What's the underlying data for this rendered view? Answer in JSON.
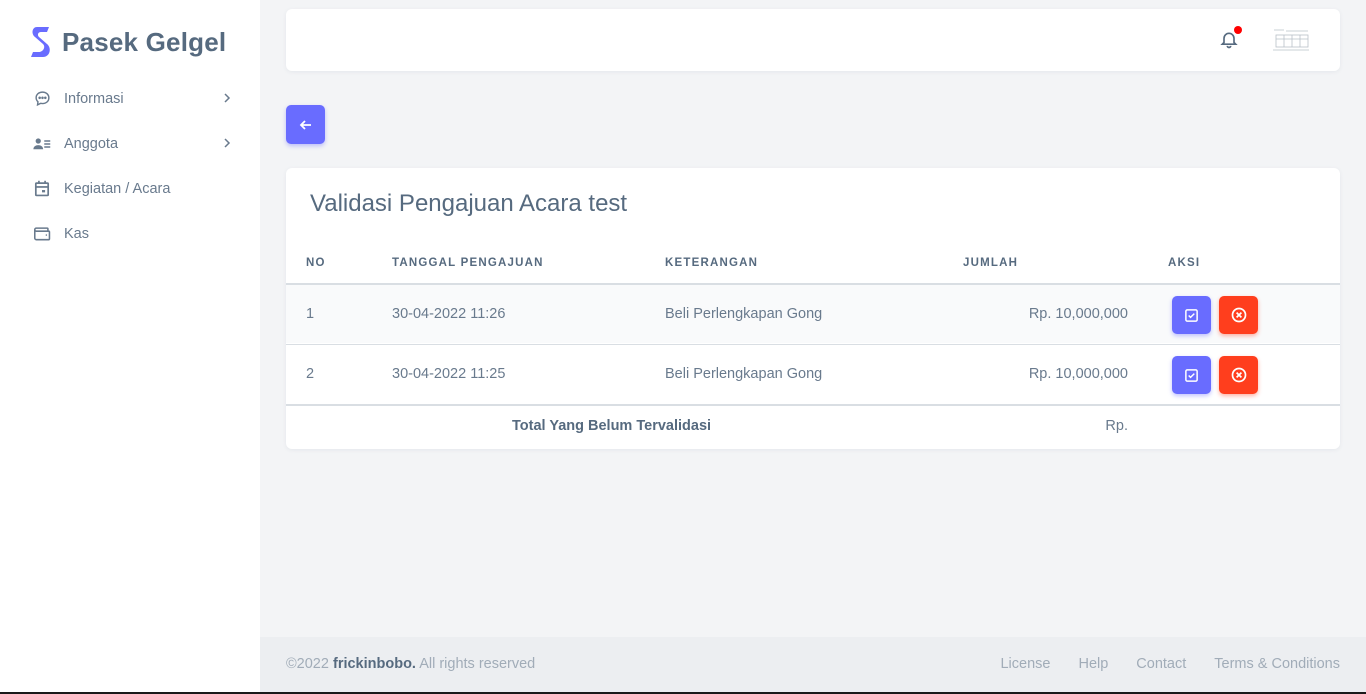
{
  "brand": {
    "name": "Pasek Gelgel",
    "color": "#696cff"
  },
  "sidebar": {
    "items": [
      {
        "label": "Informasi",
        "icon": "chat-bubble-icon",
        "has_submenu": true
      },
      {
        "label": "Anggota",
        "icon": "user-list-icon",
        "has_submenu": true
      },
      {
        "label": "Kegiatan / Acara",
        "icon": "calendar-icon",
        "has_submenu": false
      },
      {
        "label": "Kas",
        "icon": "wallet-icon",
        "has_submenu": false
      }
    ]
  },
  "navbar": {
    "notification_icon": "bell-icon",
    "has_unread": true
  },
  "back_button": {
    "icon": "arrow-left-icon"
  },
  "card": {
    "title": "Validasi Pengajuan Acara test",
    "columns": [
      "NO",
      "TANGGAL PENGAJUAN",
      "KETERANGAN",
      "JUMLAH",
      "AKSI"
    ],
    "rows": [
      {
        "no": "1",
        "tanggal": "30-04-2022 11:26",
        "keterangan": "Beli Perlengkapan Gong",
        "jumlah": "Rp. 10,000,000"
      },
      {
        "no": "2",
        "tanggal": "30-04-2022 11:25",
        "keterangan": "Beli Perlengkapan Gong",
        "jumlah": "Rp. 10,000,000"
      }
    ],
    "total_label": "Total Yang Belum Tervalidasi",
    "total_value": "Rp."
  },
  "footer": {
    "copyright_prefix": "©2022 ",
    "author": "frickinbobo.",
    "copyright_suffix": " All rights reserved",
    "links": [
      "License",
      "Help",
      "Contact",
      "Terms & Conditions"
    ]
  },
  "colors": {
    "primary": "#696cff",
    "danger": "#ff3e1d",
    "notification": "#ff0000"
  }
}
